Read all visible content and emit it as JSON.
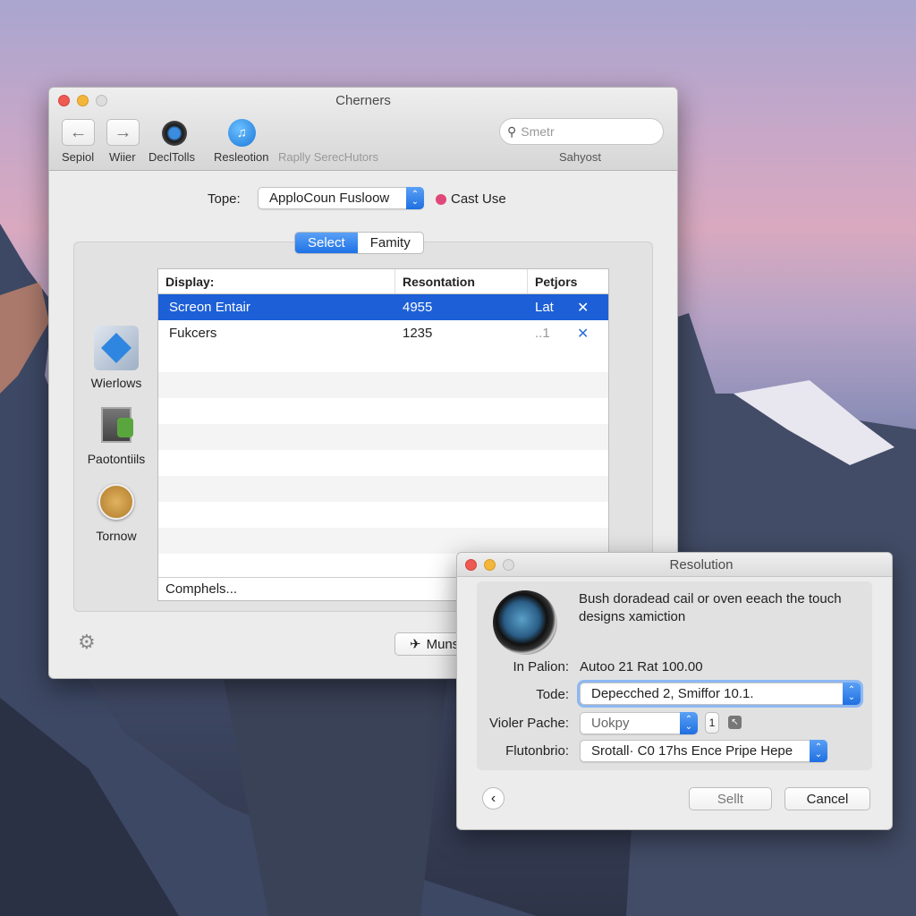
{
  "colors": {
    "accent": "#1c5fd6",
    "close": "#ee5a52",
    "minimize": "#f3b63b"
  },
  "main_window": {
    "title": "Cherners",
    "toolbar": {
      "items": [
        {
          "label": "Sepiol",
          "icon": "arrow-left-icon"
        },
        {
          "label": "Wiier",
          "icon": "arrow-right-icon"
        },
        {
          "label": "DeclTolls",
          "icon": "camera-icon"
        },
        {
          "label": "Resleotion",
          "icon": "music-icon"
        },
        {
          "label": "Raplly SerecHutors"
        }
      ],
      "search_placeholder": "Smetr",
      "search_label": "Sahyost"
    },
    "type_label": "Tope:",
    "type_value": "ApploCoun Fusloow",
    "cast_use": "Cast Use",
    "segments": [
      "Select",
      "Famity"
    ],
    "sidebar": [
      {
        "label": "Wierlows",
        "icon": "windows-icon"
      },
      {
        "label": "Paotontiils",
        "icon": "monitor-tree-icon"
      },
      {
        "label": "Tornow",
        "icon": "disk-icon"
      }
    ],
    "table": {
      "columns": [
        "Display:",
        "Resontation",
        "Petjors"
      ],
      "rows": [
        {
          "display": "Screon Entair",
          "resolution": "4955",
          "option": "Lat",
          "selected": true
        },
        {
          "display": "Fukcers",
          "resolution": "1235",
          "option": "..1",
          "selected": false
        }
      ],
      "footer": "Comphels..."
    },
    "bottom_button": "Muns"
  },
  "dialog": {
    "title": "Resolution",
    "message": "Bush doradead cail or oven eeach the touch designs xamiction",
    "fields": [
      {
        "label": "In Palion:",
        "value": "Autoo 21 Rat 100.00"
      },
      {
        "label": "Tode:",
        "value": "Depecched 2, Smiffor 10.1."
      },
      {
        "label": "Violer Pache:",
        "value": "Uokpy",
        "extra": "1"
      },
      {
        "label": "Flutonbrio:",
        "value": "Srotall· C0 17hs Ence Pripe Hepe"
      }
    ],
    "select_button": "Sellt",
    "cancel_button": "Cancel"
  }
}
